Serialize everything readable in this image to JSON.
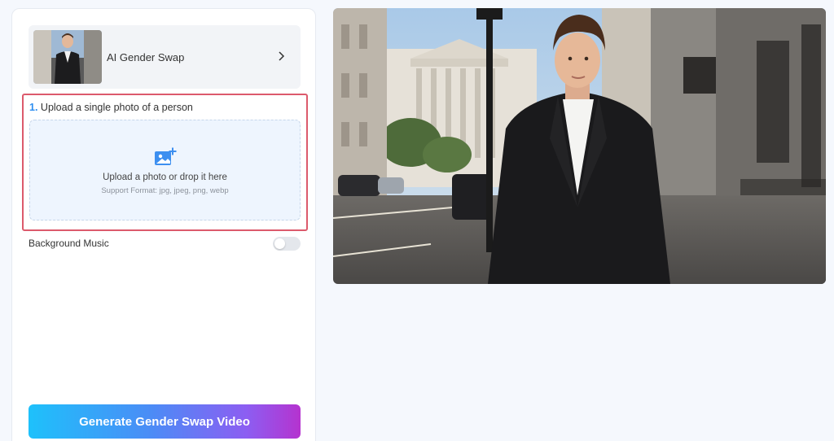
{
  "template": {
    "name": "AI Gender Swap"
  },
  "upload": {
    "step_number": "1.",
    "step_title": "Upload a single photo of a person",
    "main_text": "Upload a photo or drop it here",
    "support_text": "Support Format: jpg, jpeg, png, webp"
  },
  "background_music": {
    "label": "Background Music",
    "enabled": false
  },
  "generate": {
    "label": "Generate Gender Swap Video"
  },
  "colors": {
    "accent": "#2f8ff0",
    "highlight_border": "#dc5a6c",
    "button_gradient": [
      "#1ec1fb",
      "#4b8cf6",
      "#8c5ef2",
      "#b533cf"
    ]
  },
  "icons": [
    "chevron-right-icon",
    "image-plus-icon"
  ]
}
